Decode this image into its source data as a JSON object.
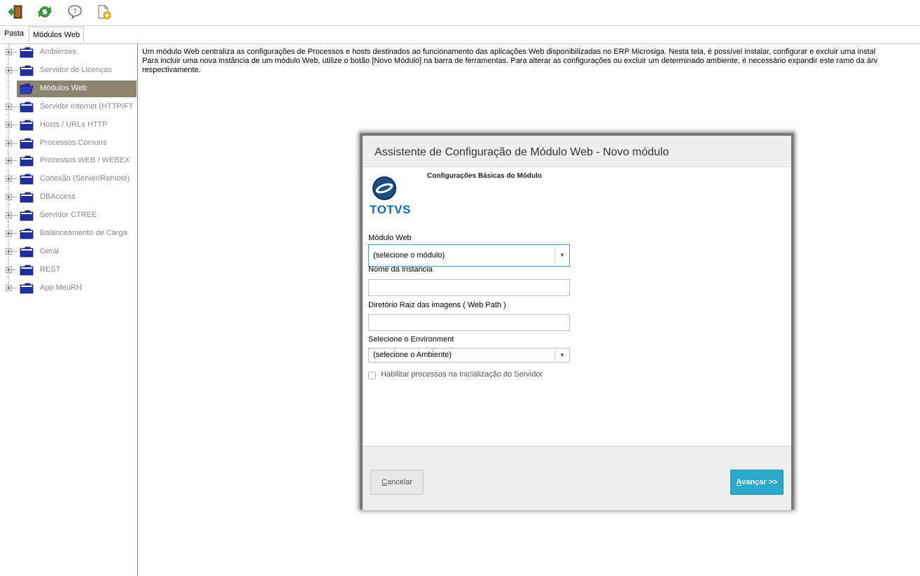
{
  "tabs": {
    "pasta_label": "Pasta",
    "active_label": "Módulos Web"
  },
  "tree": {
    "items": [
      {
        "label": "Ambientes"
      },
      {
        "label": "Servidor de Licenças"
      },
      {
        "label": "Módulos Web"
      },
      {
        "label": "Servidor Internet (HTTP/FT"
      },
      {
        "label": "Hosts / URLs HTTP"
      },
      {
        "label": "Processos Comuns"
      },
      {
        "label": "Processos WEB / WEBEX"
      },
      {
        "label": "Conexão (Server/Remote)"
      },
      {
        "label": "DBAccess"
      },
      {
        "label": "Servidor CTREE"
      },
      {
        "label": "Balanceamento de Carga"
      },
      {
        "label": "Geral"
      },
      {
        "label": "REST"
      },
      {
        "label": "App MeuRH"
      }
    ],
    "selected_label": "Módulos Web"
  },
  "description": {
    "line1": "Um módulo Web centraliza as configurações de Processos e hosts destinados ao funcionamento das aplicações Web disponibilizadas no ERP Microsiga. Nesta tela, é possível instalar, configurar e excluir uma instal",
    "line2": "Para incluir uma nova instância de um módulo Web, utilize o botão [Novo Módulo] na barra de ferramentas. Para alterar as configurações ou excluir um determinado ambiente, é necessário expandir este ramo da árv",
    "line3": "respectivamente."
  },
  "dialog": {
    "title": "Assistente de Configuração de Módulo Web - Novo módulo",
    "subtitle": "Configurações Básicas do Módulo",
    "logo_text": "TOTVS",
    "modulo_label": "Módulo Web",
    "modulo_value": "(selecione o módulo)",
    "instancia_label": "Nome da Instancia",
    "instancia_value": "",
    "diretorio_label": "Diretório Raiz das imagens ( Web Path )",
    "diretorio_value": "",
    "environment_label": "Selecione o Environment",
    "environment_value": "(selecione o Ambiente)",
    "checkbox_label": "Habilitar processos na Inicialização do Servidor",
    "cancel_label": "Cancelar",
    "next_label": "Avançar >>"
  },
  "colors": {
    "selected_bg": "#8c8370",
    "primary_button": "#29a9cc",
    "focus_border": "#37a3c6",
    "logo_blue": "#0a6fb0"
  },
  "icons": [
    "exit-icon",
    "refresh-icon",
    "help-icon",
    "new-document-icon",
    "folder-icon",
    "open-folder-icon",
    "dropdown-arrow-icon"
  ]
}
